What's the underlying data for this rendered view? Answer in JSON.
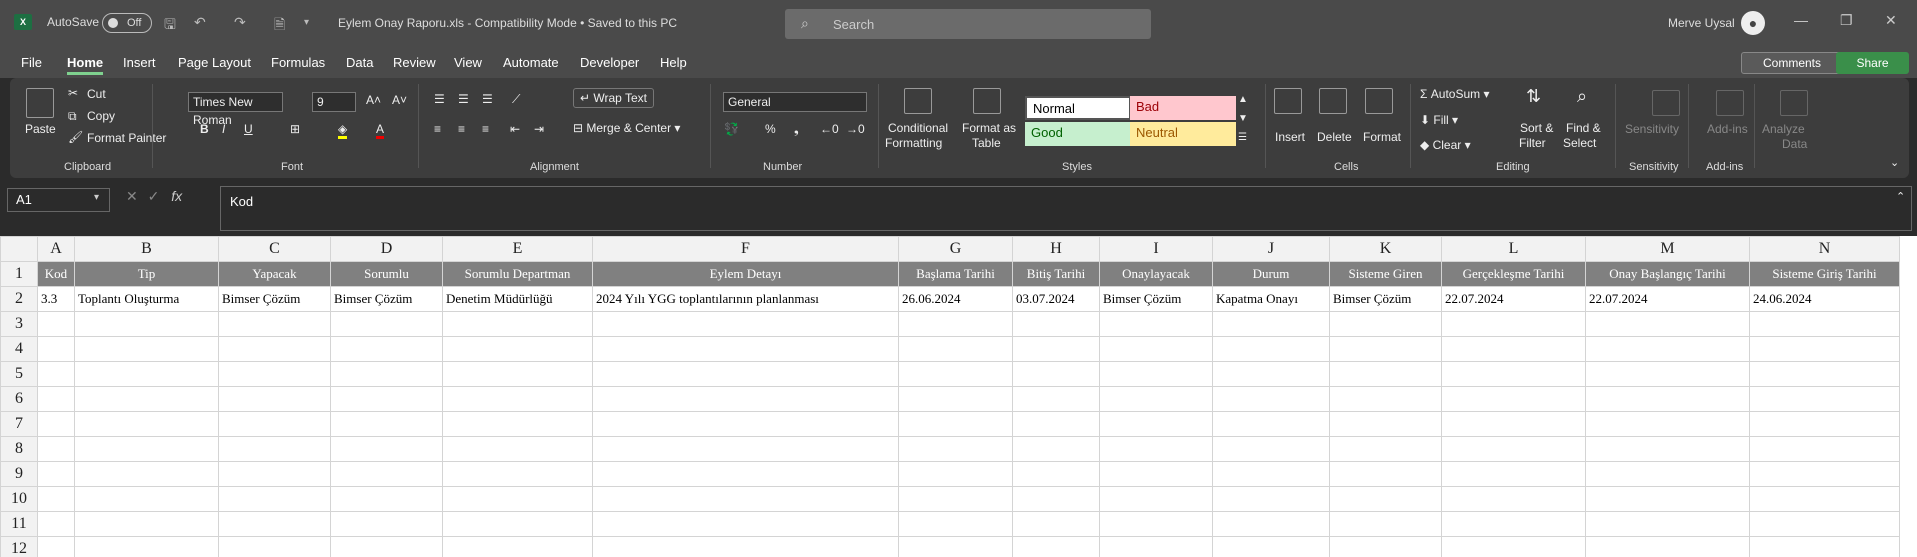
{
  "app": {
    "autosave_label": "AutoSave",
    "autosave_state": "Off",
    "doc_title": "Eylem Onay Raporu.xls  -  Compatibility Mode  •  Saved to this PC",
    "search_placeholder": "Search",
    "user_name": "Merve Uysal",
    "comments_label": "Comments",
    "share_label": "Share"
  },
  "menu": [
    "File",
    "Home",
    "Insert",
    "Page Layout",
    "Formulas",
    "Data",
    "Review",
    "View",
    "Automate",
    "Developer",
    "Help"
  ],
  "ribbon": {
    "clipboard": {
      "paste": "Paste",
      "cut": "Cut",
      "copy": "Copy",
      "format_painter": "Format Painter",
      "label": "Clipboard"
    },
    "font": {
      "name": "Times New Roman",
      "size": "9",
      "label": "Font"
    },
    "alignment": {
      "wrap": "Wrap Text",
      "merge": "Merge & Center",
      "label": "Alignment"
    },
    "number": {
      "format": "General",
      "label": "Number"
    },
    "styles": {
      "cond": "Conditional",
      "cond2": "Formatting",
      "fmt_table": "Format as",
      "fmt_table2": "Table",
      "normal": "Normal",
      "bad": "Bad",
      "good": "Good",
      "neutral": "Neutral",
      "label": "Styles"
    },
    "cells": {
      "insert": "Insert",
      "delete": "Delete",
      "format": "Format",
      "label": "Cells"
    },
    "editing": {
      "autosum": "AutoSum",
      "fill": "Fill",
      "clear": "Clear",
      "sort": "Sort &",
      "sort2": "Filter",
      "find": "Find &",
      "find2": "Select",
      "label": "Editing"
    },
    "sensitivity": {
      "btn": "Sensitivity",
      "label": "Sensitivity"
    },
    "addins": {
      "btn": "Add-ins",
      "label": "Add-ins"
    },
    "analyze": {
      "btn": "Analyze",
      "btn2": "Data"
    }
  },
  "formula": {
    "namebox": "A1",
    "fx": "fx",
    "value": "Kod"
  },
  "sheet": {
    "columns": [
      "A",
      "B",
      "C",
      "D",
      "E",
      "F",
      "G",
      "H",
      "I",
      "J",
      "K",
      "L",
      "M",
      "N"
    ],
    "rows": [
      "1",
      "2",
      "3",
      "4",
      "5",
      "6",
      "7",
      "8",
      "9",
      "10",
      "11",
      "12"
    ],
    "header_row": [
      "Kod",
      "Tip",
      "Yapacak",
      "Sorumlu",
      "Sorumlu Departman",
      "Eylem Detayı",
      "Başlama Tarihi",
      "Bitiş Tarihi",
      "Onaylayacak",
      "Durum",
      "Sisteme Giren",
      "Gerçekleşme Tarihi",
      "Onay Başlangıç Tarihi",
      "Sisteme Giriş Tarihi"
    ],
    "data_row": [
      "3.3",
      "Toplantı Oluşturma",
      "Bimser Çözüm",
      "Bimser Çözüm",
      "Denetim Müdürlüğü",
      "2024 Yılı YGG toplantılarının planlanması",
      "26.06.2024",
      "03.07.2024",
      "Bimser Çözüm",
      "Kapatma Onayı",
      "Bimser Çözüm",
      "22.07.2024",
      "22.07.2024",
      "24.06.2024"
    ]
  }
}
